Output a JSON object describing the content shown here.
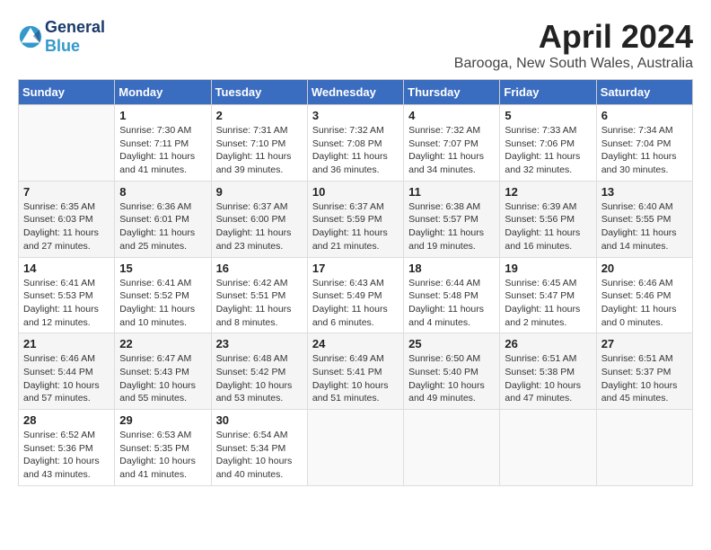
{
  "header": {
    "logo_general": "General",
    "logo_blue": "Blue",
    "month_title": "April 2024",
    "location": "Barooga, New South Wales, Australia"
  },
  "weekdays": [
    "Sunday",
    "Monday",
    "Tuesday",
    "Wednesday",
    "Thursday",
    "Friday",
    "Saturday"
  ],
  "weeks": [
    [
      {
        "day": "",
        "info": ""
      },
      {
        "day": "1",
        "info": "Sunrise: 7:30 AM\nSunset: 7:11 PM\nDaylight: 11 hours\nand 41 minutes."
      },
      {
        "day": "2",
        "info": "Sunrise: 7:31 AM\nSunset: 7:10 PM\nDaylight: 11 hours\nand 39 minutes."
      },
      {
        "day": "3",
        "info": "Sunrise: 7:32 AM\nSunset: 7:08 PM\nDaylight: 11 hours\nand 36 minutes."
      },
      {
        "day": "4",
        "info": "Sunrise: 7:32 AM\nSunset: 7:07 PM\nDaylight: 11 hours\nand 34 minutes."
      },
      {
        "day": "5",
        "info": "Sunrise: 7:33 AM\nSunset: 7:06 PM\nDaylight: 11 hours\nand 32 minutes."
      },
      {
        "day": "6",
        "info": "Sunrise: 7:34 AM\nSunset: 7:04 PM\nDaylight: 11 hours\nand 30 minutes."
      }
    ],
    [
      {
        "day": "7",
        "info": "Sunrise: 6:35 AM\nSunset: 6:03 PM\nDaylight: 11 hours\nand 27 minutes."
      },
      {
        "day": "8",
        "info": "Sunrise: 6:36 AM\nSunset: 6:01 PM\nDaylight: 11 hours\nand 25 minutes."
      },
      {
        "day": "9",
        "info": "Sunrise: 6:37 AM\nSunset: 6:00 PM\nDaylight: 11 hours\nand 23 minutes."
      },
      {
        "day": "10",
        "info": "Sunrise: 6:37 AM\nSunset: 5:59 PM\nDaylight: 11 hours\nand 21 minutes."
      },
      {
        "day": "11",
        "info": "Sunrise: 6:38 AM\nSunset: 5:57 PM\nDaylight: 11 hours\nand 19 minutes."
      },
      {
        "day": "12",
        "info": "Sunrise: 6:39 AM\nSunset: 5:56 PM\nDaylight: 11 hours\nand 16 minutes."
      },
      {
        "day": "13",
        "info": "Sunrise: 6:40 AM\nSunset: 5:55 PM\nDaylight: 11 hours\nand 14 minutes."
      }
    ],
    [
      {
        "day": "14",
        "info": "Sunrise: 6:41 AM\nSunset: 5:53 PM\nDaylight: 11 hours\nand 12 minutes."
      },
      {
        "day": "15",
        "info": "Sunrise: 6:41 AM\nSunset: 5:52 PM\nDaylight: 11 hours\nand 10 minutes."
      },
      {
        "day": "16",
        "info": "Sunrise: 6:42 AM\nSunset: 5:51 PM\nDaylight: 11 hours\nand 8 minutes."
      },
      {
        "day": "17",
        "info": "Sunrise: 6:43 AM\nSunset: 5:49 PM\nDaylight: 11 hours\nand 6 minutes."
      },
      {
        "day": "18",
        "info": "Sunrise: 6:44 AM\nSunset: 5:48 PM\nDaylight: 11 hours\nand 4 minutes."
      },
      {
        "day": "19",
        "info": "Sunrise: 6:45 AM\nSunset: 5:47 PM\nDaylight: 11 hours\nand 2 minutes."
      },
      {
        "day": "20",
        "info": "Sunrise: 6:46 AM\nSunset: 5:46 PM\nDaylight: 11 hours\nand 0 minutes."
      }
    ],
    [
      {
        "day": "21",
        "info": "Sunrise: 6:46 AM\nSunset: 5:44 PM\nDaylight: 10 hours\nand 57 minutes."
      },
      {
        "day": "22",
        "info": "Sunrise: 6:47 AM\nSunset: 5:43 PM\nDaylight: 10 hours\nand 55 minutes."
      },
      {
        "day": "23",
        "info": "Sunrise: 6:48 AM\nSunset: 5:42 PM\nDaylight: 10 hours\nand 53 minutes."
      },
      {
        "day": "24",
        "info": "Sunrise: 6:49 AM\nSunset: 5:41 PM\nDaylight: 10 hours\nand 51 minutes."
      },
      {
        "day": "25",
        "info": "Sunrise: 6:50 AM\nSunset: 5:40 PM\nDaylight: 10 hours\nand 49 minutes."
      },
      {
        "day": "26",
        "info": "Sunrise: 6:51 AM\nSunset: 5:38 PM\nDaylight: 10 hours\nand 47 minutes."
      },
      {
        "day": "27",
        "info": "Sunrise: 6:51 AM\nSunset: 5:37 PM\nDaylight: 10 hours\nand 45 minutes."
      }
    ],
    [
      {
        "day": "28",
        "info": "Sunrise: 6:52 AM\nSunset: 5:36 PM\nDaylight: 10 hours\nand 43 minutes."
      },
      {
        "day": "29",
        "info": "Sunrise: 6:53 AM\nSunset: 5:35 PM\nDaylight: 10 hours\nand 41 minutes."
      },
      {
        "day": "30",
        "info": "Sunrise: 6:54 AM\nSunset: 5:34 PM\nDaylight: 10 hours\nand 40 minutes."
      },
      {
        "day": "",
        "info": ""
      },
      {
        "day": "",
        "info": ""
      },
      {
        "day": "",
        "info": ""
      },
      {
        "day": "",
        "info": ""
      }
    ]
  ]
}
